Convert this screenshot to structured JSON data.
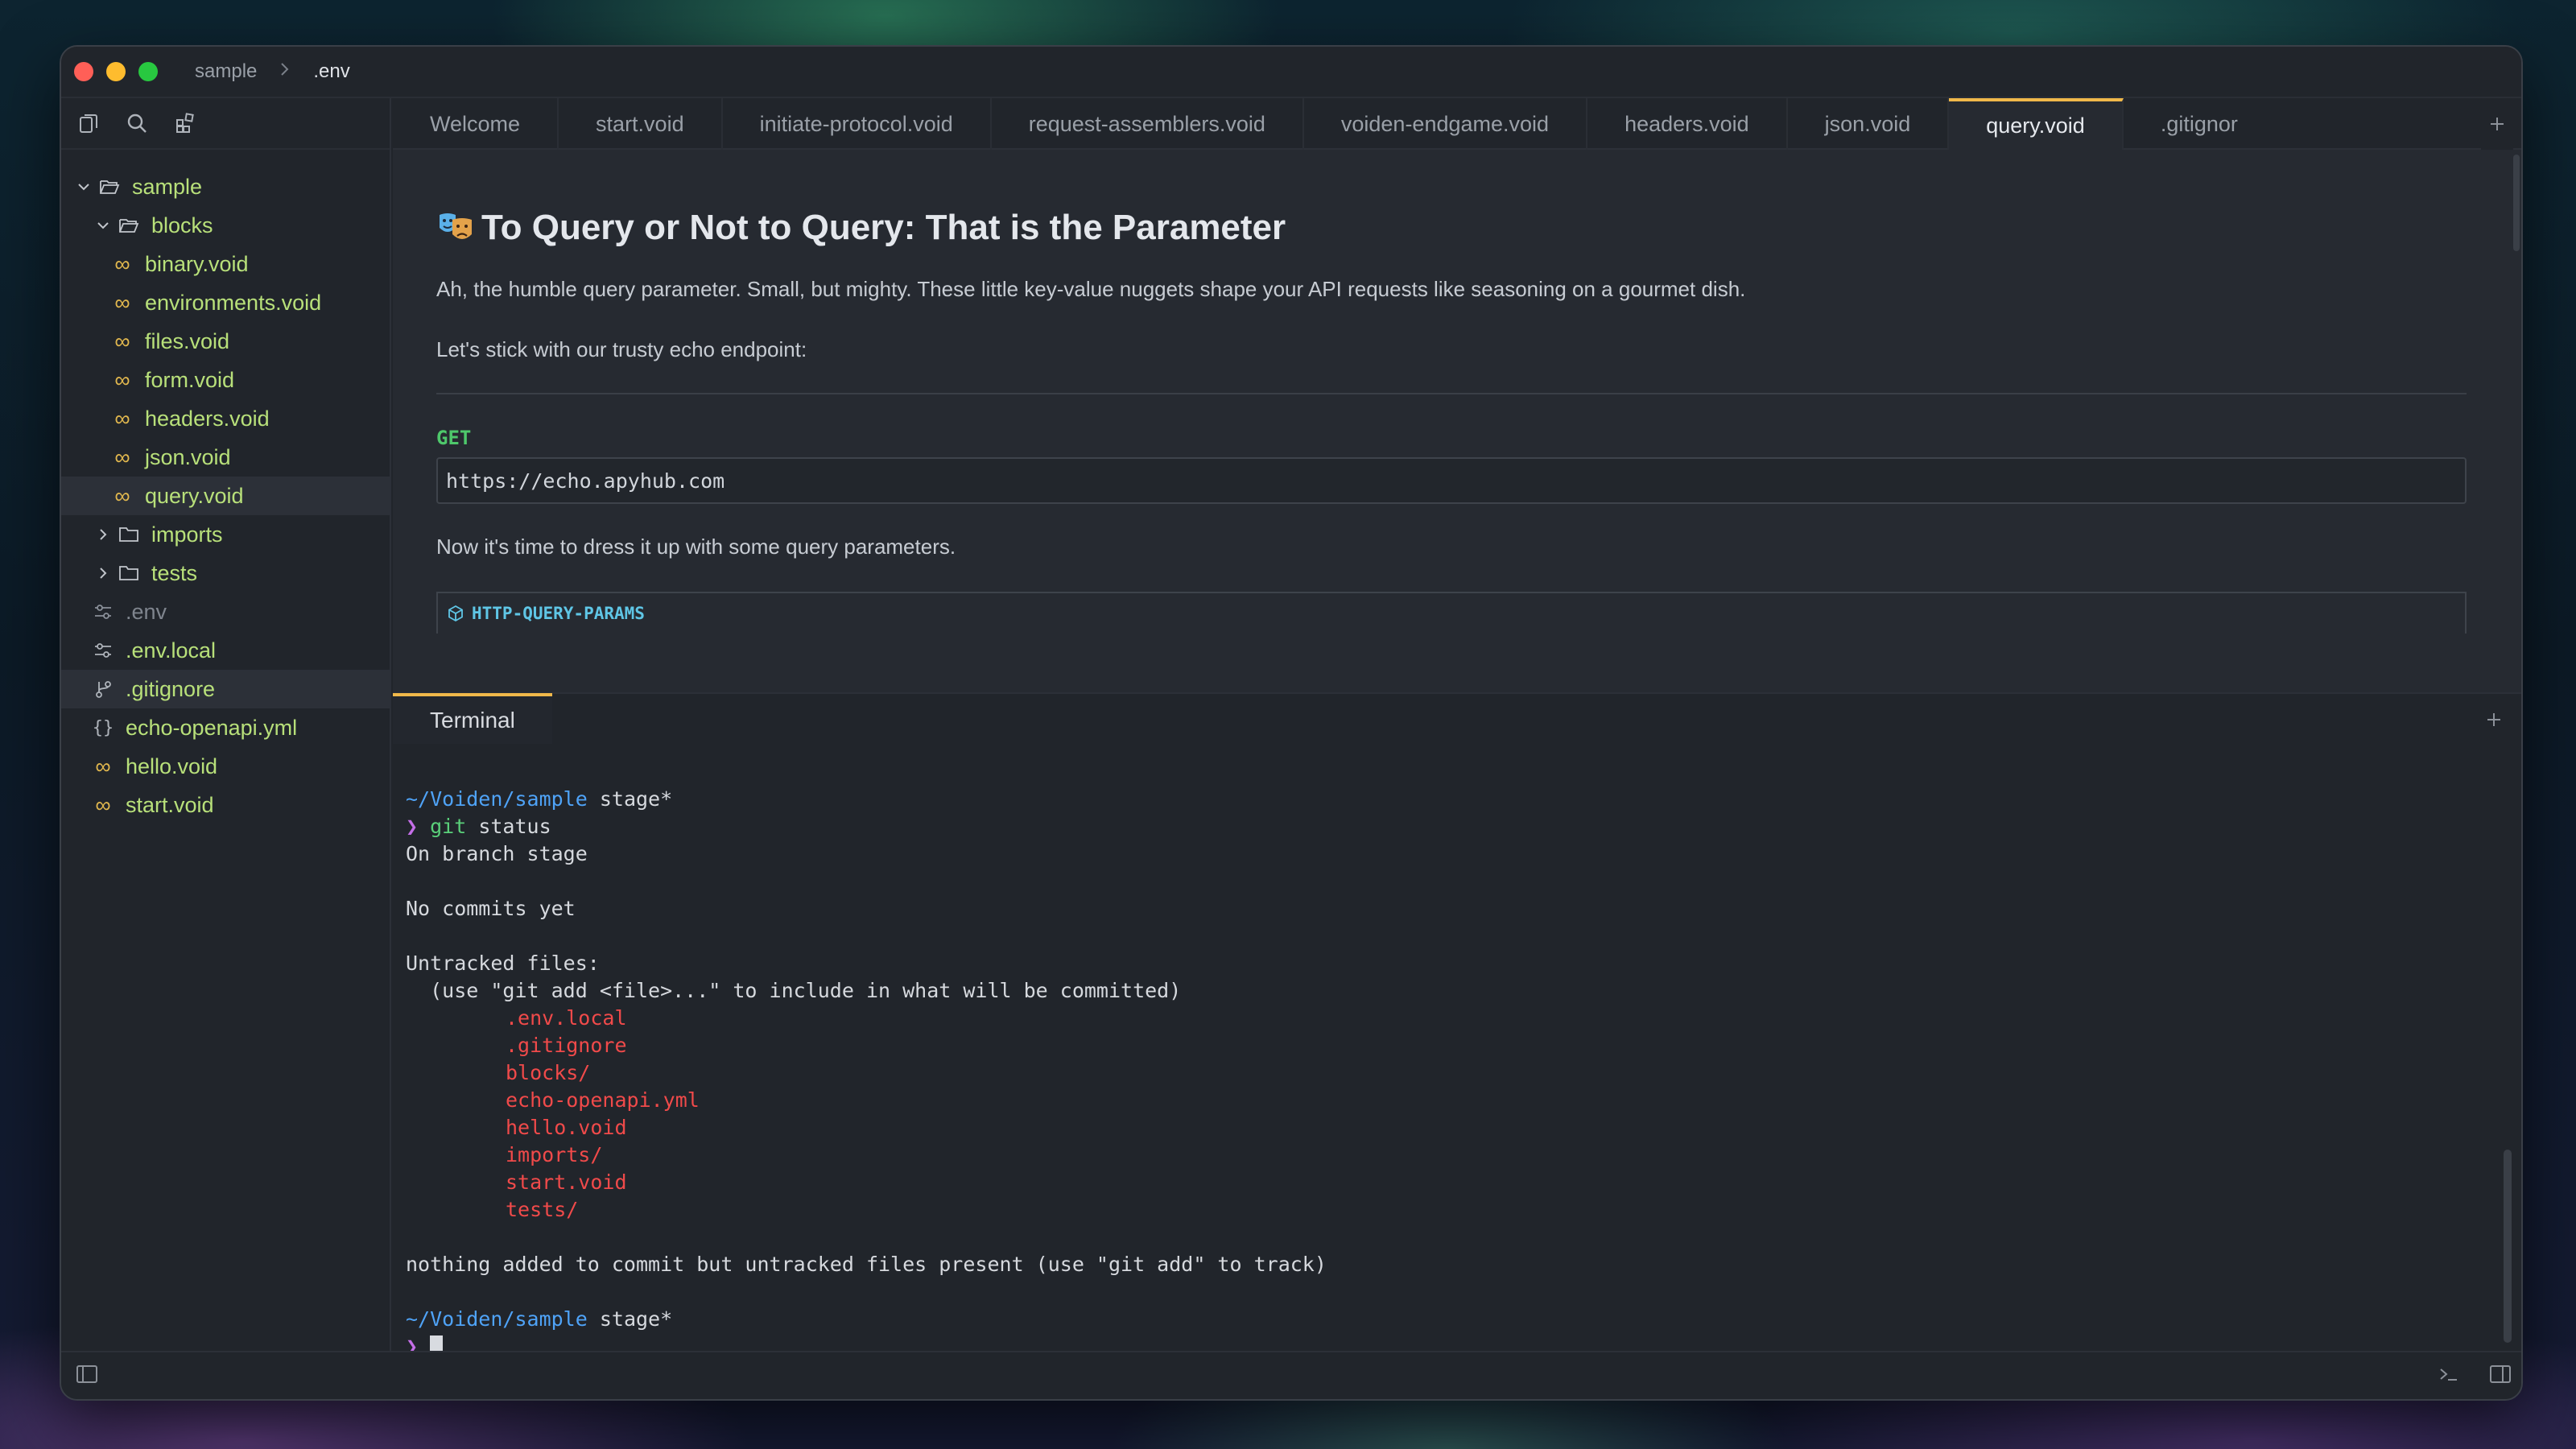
{
  "titlebar": {
    "crumbs": [
      "sample",
      ".env"
    ]
  },
  "sidebar": {
    "tools": [
      "files-icon",
      "search-icon",
      "blocks-icon"
    ],
    "tree": [
      {
        "label": "sample",
        "type": "folder-open",
        "depth": 0
      },
      {
        "label": "blocks",
        "type": "folder-open",
        "depth": 1
      },
      {
        "label": "binary.void",
        "type": "void",
        "depth": 2
      },
      {
        "label": "environments.void",
        "type": "void",
        "depth": 2
      },
      {
        "label": "files.void",
        "type": "void",
        "depth": 2
      },
      {
        "label": "form.void",
        "type": "void",
        "depth": 2
      },
      {
        "label": "headers.void",
        "type": "void",
        "depth": 2
      },
      {
        "label": "json.void",
        "type": "void",
        "depth": 2
      },
      {
        "label": "query.void",
        "type": "void",
        "depth": 2,
        "selected": true
      },
      {
        "label": "imports",
        "type": "folder-closed",
        "depth": 1
      },
      {
        "label": "tests",
        "type": "folder-closed",
        "depth": 1
      },
      {
        "label": ".env",
        "type": "env",
        "depth": 1
      },
      {
        "label": ".env.local",
        "type": "env",
        "depth": 1
      },
      {
        "label": ".gitignore",
        "type": "git",
        "depth": 1
      },
      {
        "label": "echo-openapi.yml",
        "type": "yaml",
        "depth": 1
      },
      {
        "label": "hello.void",
        "type": "void",
        "depth": 1
      },
      {
        "label": "start.void",
        "type": "void",
        "depth": 1
      }
    ]
  },
  "tabs": [
    {
      "label": "Welcome"
    },
    {
      "label": "start.void"
    },
    {
      "label": "initiate-protocol.void"
    },
    {
      "label": "request-assemblers.void"
    },
    {
      "label": "voiden-endgame.void"
    },
    {
      "label": "headers.void"
    },
    {
      "label": "json.void"
    },
    {
      "label": "query.void",
      "active": true
    },
    {
      "label": ".gitignor"
    }
  ],
  "editor": {
    "heading": "To Query or Not to Query: That is the Parameter",
    "para1": "Ah, the humble query parameter. Small, but mighty. These little key-value nuggets shape your API requests like seasoning on a gourmet dish.",
    "para2": "Let's stick with our trusty echo endpoint:",
    "method": "GET",
    "url": "https://echo.apyhub.com",
    "para3": "Now it's time to dress it up with some query parameters.",
    "block_label": "HTTP-QUERY-PARAMS"
  },
  "terminal": {
    "tab_label": "Terminal",
    "path": "~/Voiden/sample",
    "branch": "stage*",
    "prompt": "❯",
    "command": "git",
    "command_args": " status",
    "out1": "On branch stage",
    "out2": "No commits yet",
    "out3": "Untracked files:",
    "out4": "  (use \"git add <file>...\" to include in what will be committed)",
    "untracked": [
      ".env.local",
      ".gitignore",
      "blocks/",
      "echo-openapi.yml",
      "hello.void",
      "imports/",
      "start.void",
      "tests/"
    ],
    "out5": "nothing added to commit but untracked files present (use \"git add\" to track)"
  }
}
